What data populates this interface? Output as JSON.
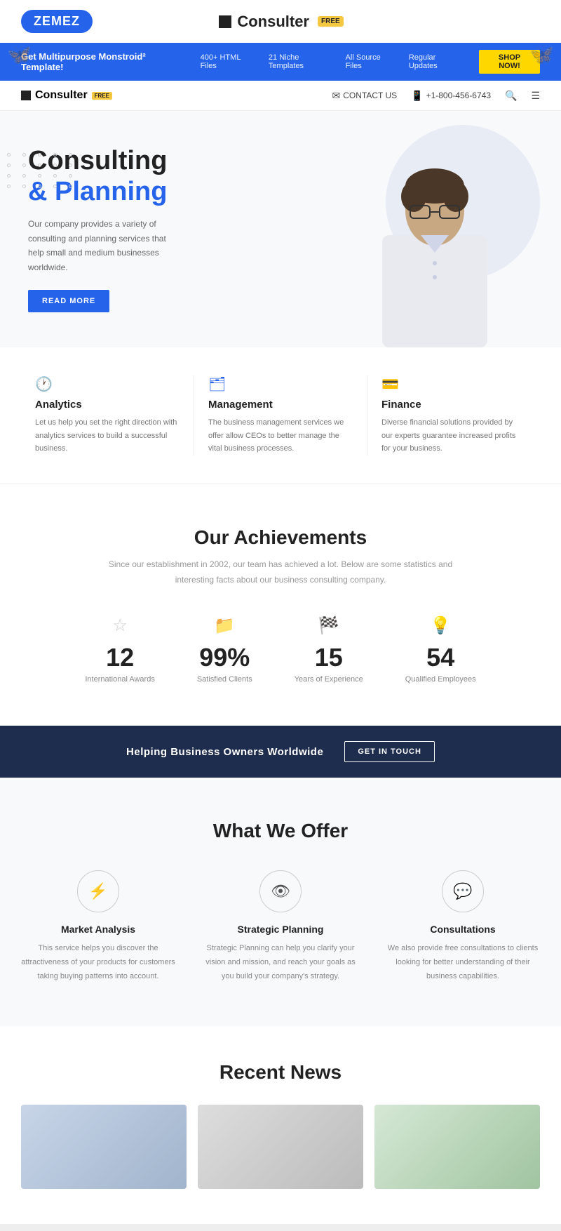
{
  "brand_bar": {
    "zemez_label": "ZEMEZ",
    "consulter_label": "Consulter",
    "free_label": "FREE"
  },
  "promo_banner": {
    "main_text": "Get Multipurpose Monstroid² Template!",
    "stat1": "400+ HTML Files",
    "stat2": "21 Niche Templates",
    "stat3": "All Source Files",
    "stat4": "Regular Updates",
    "shop_label": "SHOP NOW!"
  },
  "navbar": {
    "logo_text": "Consulter",
    "free_label": "FREE",
    "contact_label": "CONTACT US",
    "phone": "+1-800-456-6743"
  },
  "hero": {
    "title_line1": "Consulting",
    "title_accent": "& Planning",
    "subtitle": "Our company provides a variety of consulting and planning services that help small and medium businesses worldwide.",
    "read_more": "READ MORE"
  },
  "services": [
    {
      "icon": "🕐",
      "title": "Analytics",
      "desc": "Let us help you set the right direction with analytics services to build a successful business."
    },
    {
      "icon": "🗂",
      "title": "Management",
      "desc": "The business management services we offer allow CEOs to better manage the vital business processes."
    },
    {
      "icon": "💳",
      "title": "Finance",
      "desc": "Diverse financial solutions provided by our experts guarantee increased profits for your business."
    }
  ],
  "achievements": {
    "title": "Our Achievements",
    "subtitle": "Since our establishment in 2002, our team has achieved a lot. Below are some statistics and interesting facts about our business consulting company.",
    "stats": [
      {
        "icon": "☆",
        "number": "12",
        "label": "International Awards"
      },
      {
        "icon": "📁",
        "number": "99%",
        "label": "Satisfied Clients"
      },
      {
        "icon": "🏴",
        "number": "15",
        "label": "Years of Experience"
      },
      {
        "icon": "💡",
        "number": "54",
        "label": "Qualified Employees"
      }
    ]
  },
  "cta": {
    "text": "Helping Business Owners Worldwide",
    "button": "GET IN TOUCH"
  },
  "offers": {
    "title": "What We Offer",
    "items": [
      {
        "icon": "⚡",
        "title": "Market Analysis",
        "desc": "This service helps you discover the attractiveness of your products for customers taking buying patterns into account."
      },
      {
        "icon": "👁",
        "title": "Strategic Planning",
        "desc": "Strategic Planning can help you clarify your vision and mission, and reach your goals as you build your company's strategy."
      },
      {
        "icon": "💬",
        "title": "Consultations",
        "desc": "We also provide free consultations to clients looking for better understanding of their business capabilities."
      }
    ]
  },
  "recent_news": {
    "title": "Recent News"
  }
}
